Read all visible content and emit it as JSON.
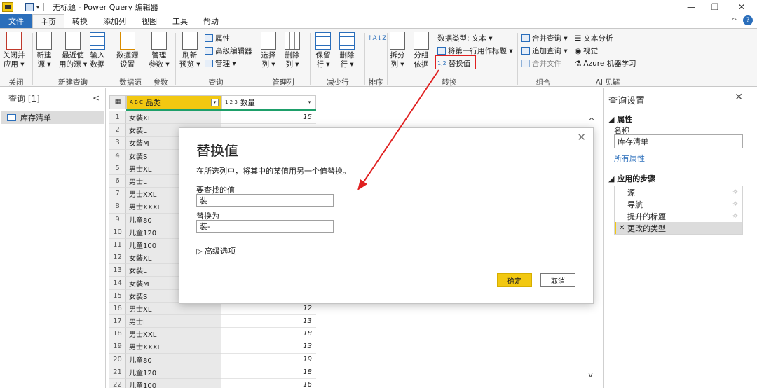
{
  "titlebar": {
    "title": "无标题 - Power Query 编辑器",
    "quick_access_dropdown": "▾",
    "min": "—",
    "restore": "❐",
    "close": "✕"
  },
  "tabs": {
    "file": "文件",
    "items": [
      "主页",
      "转换",
      "添加列",
      "视图",
      "工具",
      "帮助"
    ],
    "collapse": "^",
    "help": "?"
  },
  "ribbon": {
    "close_apply": "关闭并\n应用 ▾",
    "new_source": "新建\n源 ▾",
    "recent_sources": "最近使\n用的源 ▾",
    "enter_data": "输入\n数据",
    "ds_settings": "数据源\n设置",
    "manage_params": "管理\n参数 ▾",
    "refresh_preview": "刷新\n预览 ▾",
    "properties": "属性",
    "advanced_editor": "高级编辑器",
    "manage": "管理 ▾",
    "choose_columns": "选择\n列 ▾",
    "remove_columns": "删除\n列 ▾",
    "keep_rows": "保留\n行 ▾",
    "remove_rows": "删除\n行 ▾",
    "sort_az": "↑A↓Z",
    "split_column": "拆分\n列 ▾",
    "group_by": "分组\n依据",
    "data_type": "数据类型: 文本 ▾",
    "first_row_header": "将第一行用作标题 ▾",
    "replace_values": "替换值",
    "replace_icon_text": "1,2",
    "merge_queries": "合并查询 ▾",
    "append_queries": "追加查询 ▾",
    "combine_files": "合并文件",
    "text_analytics": "文本分析",
    "vision": "视觉",
    "azure_ml": "Azure 机器学习",
    "groups": {
      "close": "关闭",
      "new_query": "新建查询",
      "data_sources": "数据源",
      "parameters": "参数",
      "query": "查询",
      "manage_columns": "管理列",
      "reduce_rows": "减少行",
      "sort": "排序",
      "transform": "转换",
      "combine": "组合",
      "ai_insights": "AI 见解"
    }
  },
  "query_pane": {
    "title": "查询 [1]",
    "collapse": "<",
    "items": [
      "库存清单"
    ]
  },
  "grid": {
    "col1_type": "A B C",
    "col1_name": "品类",
    "col2_type": "1 2 3",
    "col2_name": "数量",
    "dd": "▾",
    "corner": "▦",
    "rows": [
      {
        "n": "1",
        "cat": "女装XL",
        "qty": "15"
      },
      {
        "n": "2",
        "cat": "女装L",
        "qty": ""
      },
      {
        "n": "3",
        "cat": "女装M",
        "qty": ""
      },
      {
        "n": "4",
        "cat": "女装S",
        "qty": ""
      },
      {
        "n": "5",
        "cat": "男士XL",
        "qty": ""
      },
      {
        "n": "6",
        "cat": "男士L",
        "qty": ""
      },
      {
        "n": "7",
        "cat": "男士XXL",
        "qty": ""
      },
      {
        "n": "8",
        "cat": "男士XXXL",
        "qty": ""
      },
      {
        "n": "9",
        "cat": "儿童80",
        "qty": ""
      },
      {
        "n": "10",
        "cat": "儿童120",
        "qty": ""
      },
      {
        "n": "11",
        "cat": "儿童100",
        "qty": ""
      },
      {
        "n": "12",
        "cat": "女装XL",
        "qty": ""
      },
      {
        "n": "13",
        "cat": "女装L",
        "qty": ""
      },
      {
        "n": "14",
        "cat": "女装M",
        "qty": ""
      },
      {
        "n": "15",
        "cat": "女装S",
        "qty": ""
      },
      {
        "n": "16",
        "cat": "男士XL",
        "qty": "12"
      },
      {
        "n": "17",
        "cat": "男士L",
        "qty": "13"
      },
      {
        "n": "18",
        "cat": "男士XXL",
        "qty": "18"
      },
      {
        "n": "19",
        "cat": "男士XXXL",
        "qty": "13"
      },
      {
        "n": "20",
        "cat": "儿童80",
        "qty": "19"
      },
      {
        "n": "21",
        "cat": "儿童120",
        "qty": "18"
      },
      {
        "n": "22",
        "cat": "儿童100",
        "qty": "16"
      }
    ]
  },
  "settings_pane": {
    "title": "查询设置",
    "close": "✕",
    "properties_header": "◢ 属性",
    "name_label": "名称",
    "name_value": "库存清单",
    "all_properties": "所有属性",
    "steps_header": "◢ 应用的步骤",
    "steps": [
      "源",
      "导航",
      "提升的标题",
      "更改的类型"
    ],
    "gear": "☼",
    "step_x": "✕"
  },
  "dialog": {
    "title": "替换值",
    "description": "在所选列中，将其中的某值用另一个值替换。",
    "find_label": "要查找的值",
    "find_value": "装",
    "replace_label": "替换为",
    "replace_value": "装-",
    "advanced": "▷ 高级选项",
    "ok": "确定",
    "cancel": "取消",
    "close": "✕"
  },
  "scroll": {
    "up": "^",
    "down": "v"
  },
  "colors": {
    "accent_blue": "#2a6ebb",
    "pbi_yellow": "#f2c811",
    "highlight_red": "#e02020"
  }
}
